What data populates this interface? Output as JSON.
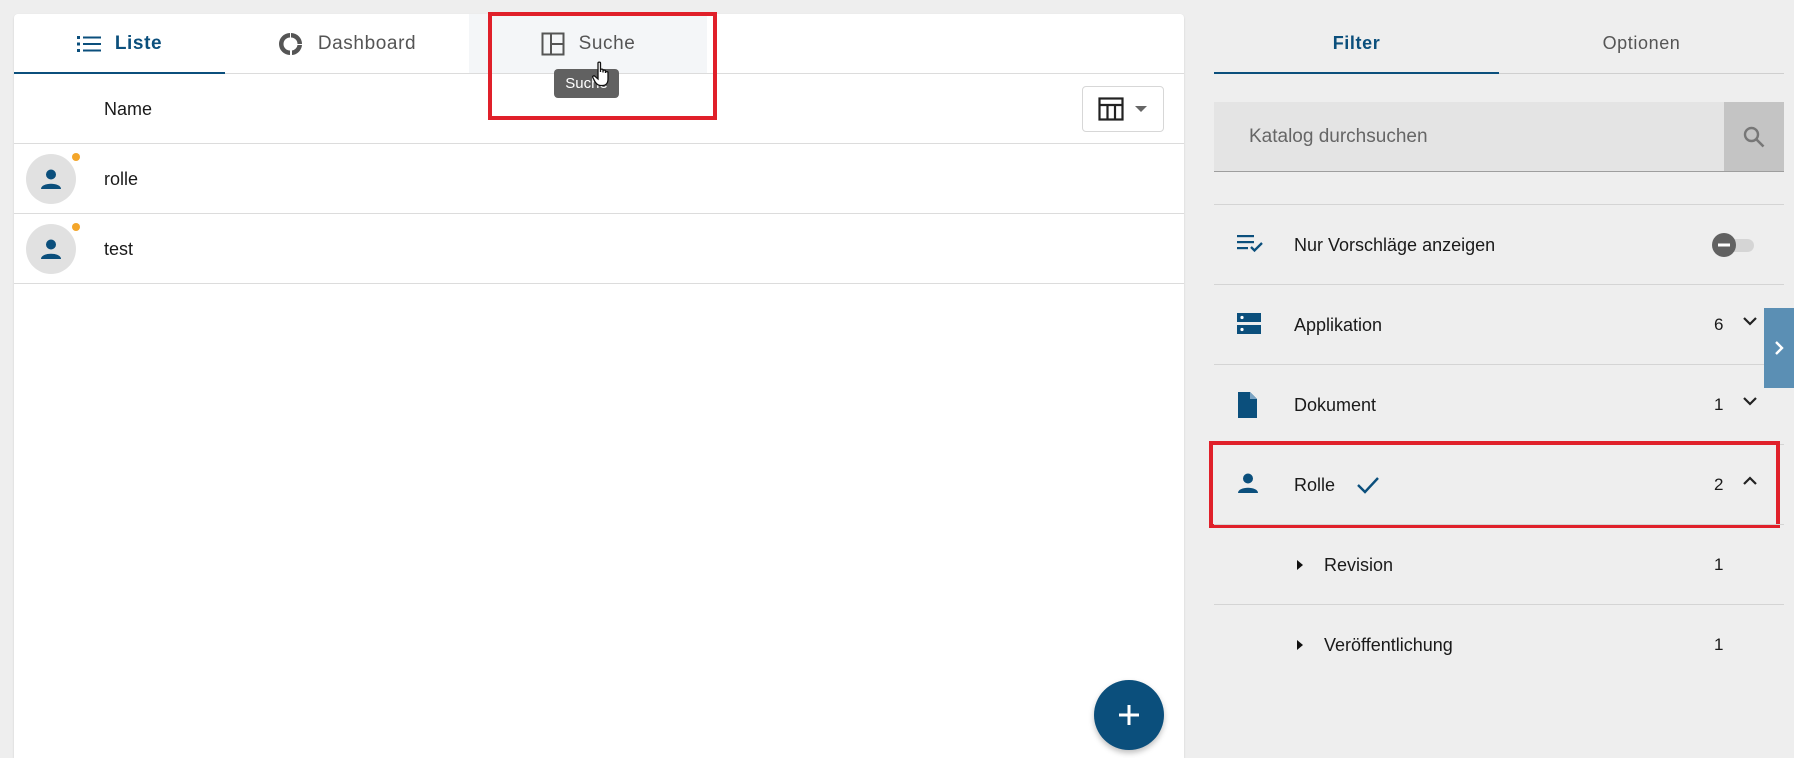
{
  "tabs": [
    {
      "label": "Liste"
    },
    {
      "label": "Dashboard"
    },
    {
      "label": "Suche"
    }
  ],
  "tooltip": "Suche",
  "list": {
    "column_name": "Name",
    "rows": [
      {
        "label": "rolle"
      },
      {
        "label": "test"
      }
    ]
  },
  "right_tabs": [
    {
      "label": "Filter"
    },
    {
      "label": "Optionen"
    }
  ],
  "search": {
    "placeholder": "Katalog durchsuchen"
  },
  "filters": {
    "suggestions": {
      "label": "Nur Vorschläge anzeigen"
    },
    "items": [
      {
        "label": "Applikation",
        "count": "6"
      },
      {
        "label": "Dokument",
        "count": "1"
      },
      {
        "label": "Rolle",
        "count": "2"
      }
    ],
    "sub_items": [
      {
        "label": "Revision",
        "count": "1"
      },
      {
        "label": "Veröffentlichung",
        "count": "1"
      }
    ]
  },
  "colors": {
    "primary": "#0b4f7c",
    "highlight": "#e0202a",
    "status_dot": "#f4a62a"
  }
}
